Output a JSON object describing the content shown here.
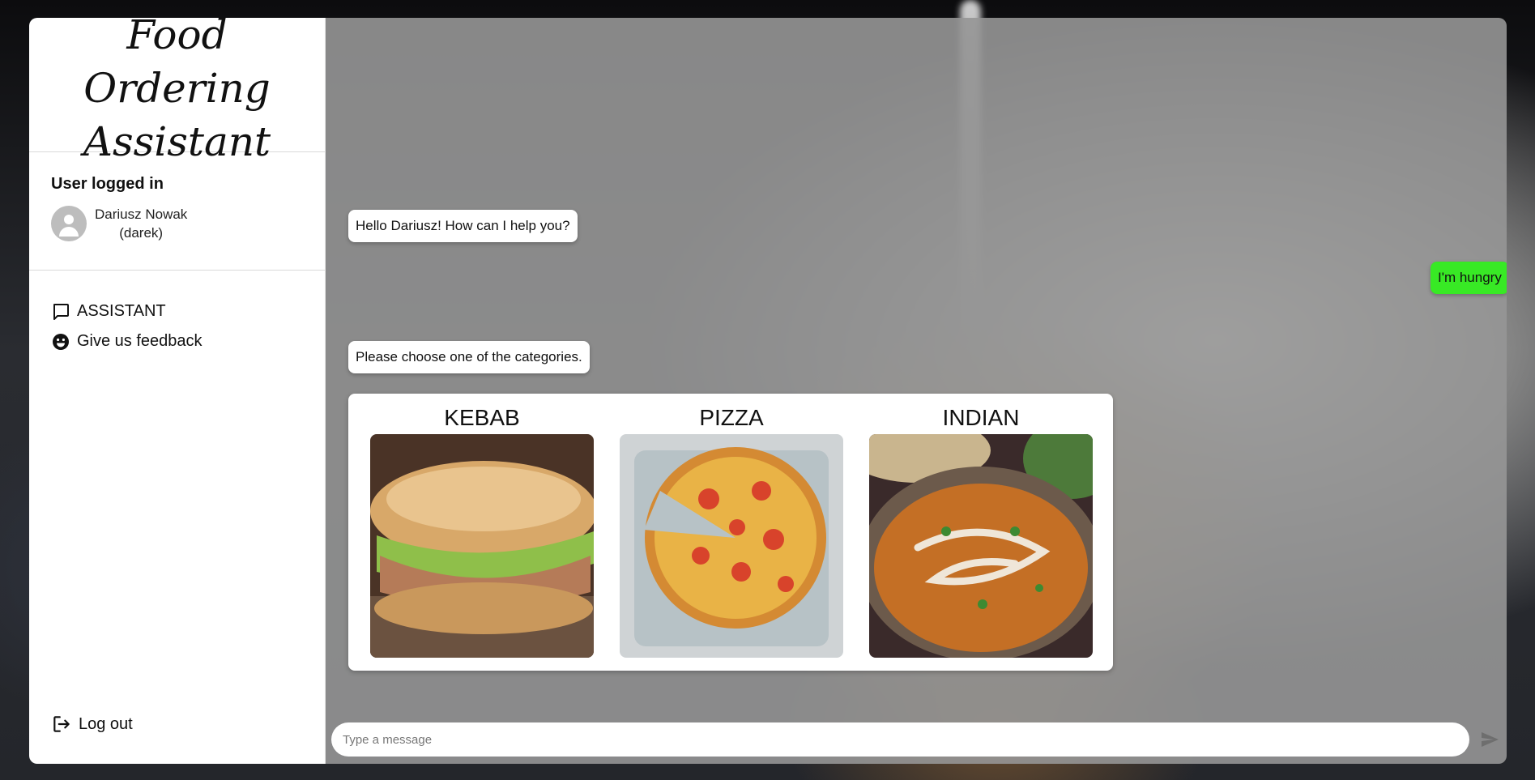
{
  "app": {
    "title": "Food Ordering Assistant"
  },
  "sidebar": {
    "user_heading": "User logged in",
    "user_name": "Dariusz Nowak",
    "user_login": "(darek)",
    "nav": [
      {
        "label": "ASSISTANT",
        "icon": "chat-bubble-icon"
      },
      {
        "label": "Give us feedback",
        "icon": "smiley-icon"
      }
    ],
    "logout_label": "Log out"
  },
  "chat": {
    "messages": [
      {
        "from": "bot",
        "text": "Hello Dariusz! How can I help you?"
      },
      {
        "from": "user",
        "text": "I'm hungry"
      },
      {
        "from": "bot",
        "text": "Please choose one of the categories."
      }
    ],
    "categories": [
      {
        "label": "KEBAB",
        "image": "kebab-photo"
      },
      {
        "label": "PIZZA",
        "image": "pizza-photo"
      },
      {
        "label": "INDIAN",
        "image": "indian-curry-photo"
      }
    ],
    "input_placeholder": "Type a message",
    "send_icon": "send-icon"
  },
  "colors": {
    "user_bubble": "#38e925",
    "bot_bubble": "#ffffff",
    "chat_overlay": "#969696"
  }
}
